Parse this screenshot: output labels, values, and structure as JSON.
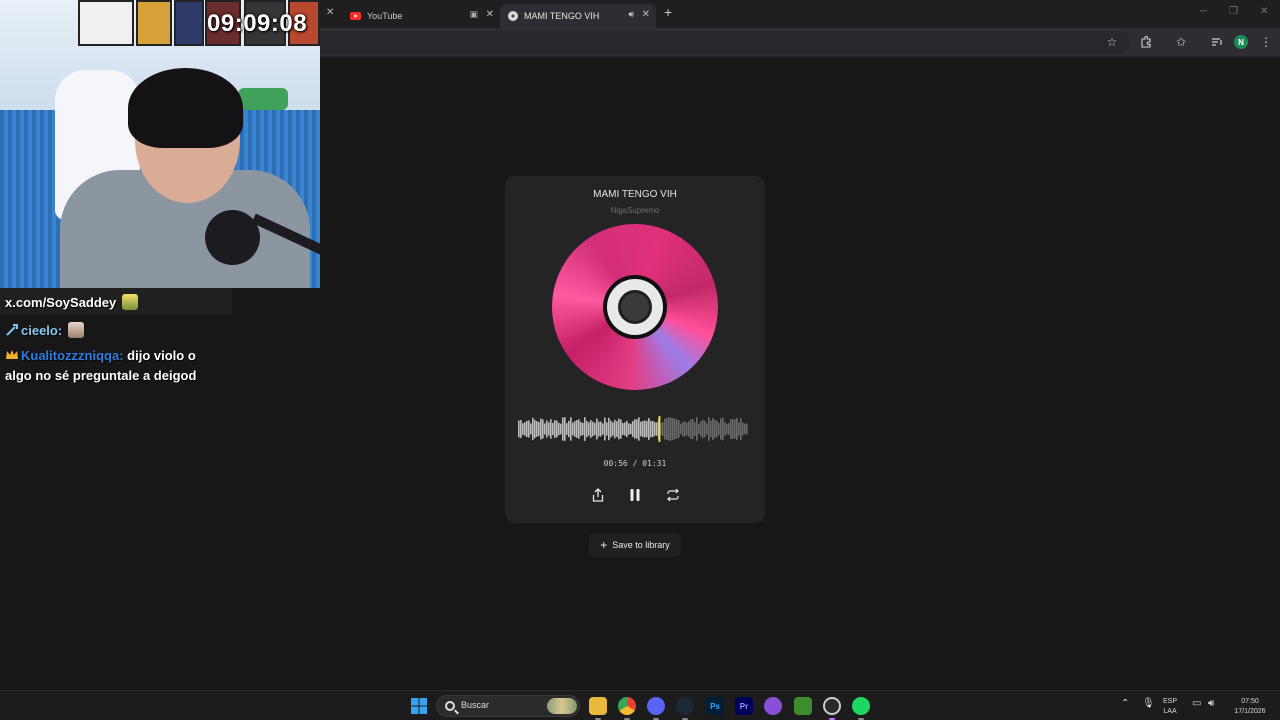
{
  "stream": {
    "clock": "09:09:08",
    "chat": [
      {
        "text": "x.com/SoySaddey"
      },
      {
        "user": "cieelo:",
        "message": ""
      },
      {
        "user": "Kualitozzzniqqa:",
        "message": "dijo violo o",
        "message_cont": "algo no sé preguntale a deigod"
      }
    ]
  },
  "browser": {
    "tabs": [
      {
        "title": "YouTube",
        "icon": "youtube-icon"
      },
      {
        "title": "MAMI TENGO VIH",
        "icon": "music-icon",
        "active": true
      }
    ],
    "avatar_letter": "N"
  },
  "player": {
    "title": "MAMI TENGO VIH",
    "artist": "NigaSupremo",
    "elapsed": "00:56",
    "duration": "01:31",
    "time_separator": "/",
    "progress": 0.615,
    "save_label": "Save to library",
    "accent": "#e8d44a"
  },
  "taskbar": {
    "search_placeholder": "Buscar",
    "apps": [
      "windows-start",
      "file-explorer",
      "chrome",
      "discord",
      "steam",
      "photoshop",
      "premiere",
      "app-purple",
      "minecraft",
      "obs",
      "spotify"
    ],
    "tray": {
      "lang": "ESP",
      "layout": "LAA",
      "time": "07:50",
      "date": "17/1/2026"
    },
    "apps_labels": {
      "photoshop": "Ps",
      "premiere": "Pr"
    }
  }
}
